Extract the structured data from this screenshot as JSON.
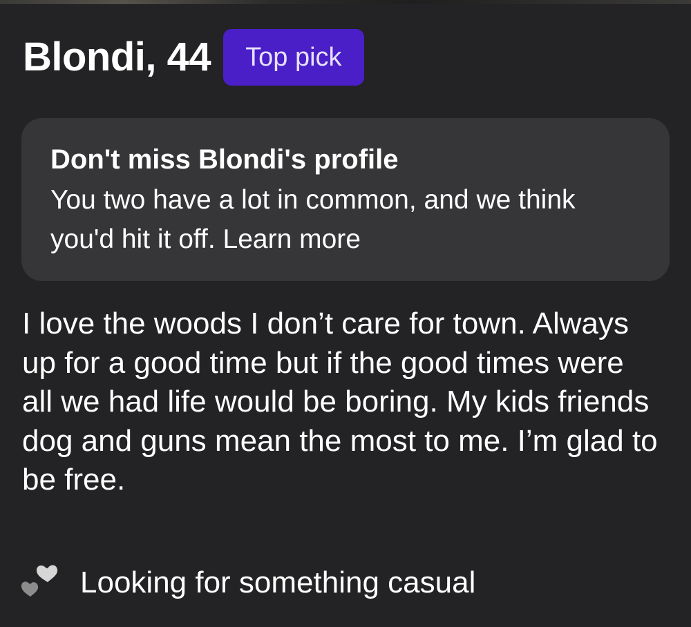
{
  "profile": {
    "name_age": "Blondi, 44",
    "badge": "Top pick"
  },
  "highlight_card": {
    "title": "Don't miss Blondi's profile",
    "body": "You two have a lot in common, and we think you'd hit it off.",
    "link_label": "Learn more"
  },
  "bio": "I love the woods I don’t care for town. Always up for a good time but if the good times were all we had life would be boring. My kids friends dog and guns mean the most to me. I’m glad to be free.",
  "looking_for": {
    "label": "Looking for something casual",
    "icon": "two-hearts-icon"
  },
  "colors": {
    "background": "#232325",
    "card": "#363638",
    "badge": "#4A1FC7",
    "badge_text": "#E7E1FF",
    "heart_light": "#D6D6D6",
    "heart_dark": "#8C8C8C"
  }
}
